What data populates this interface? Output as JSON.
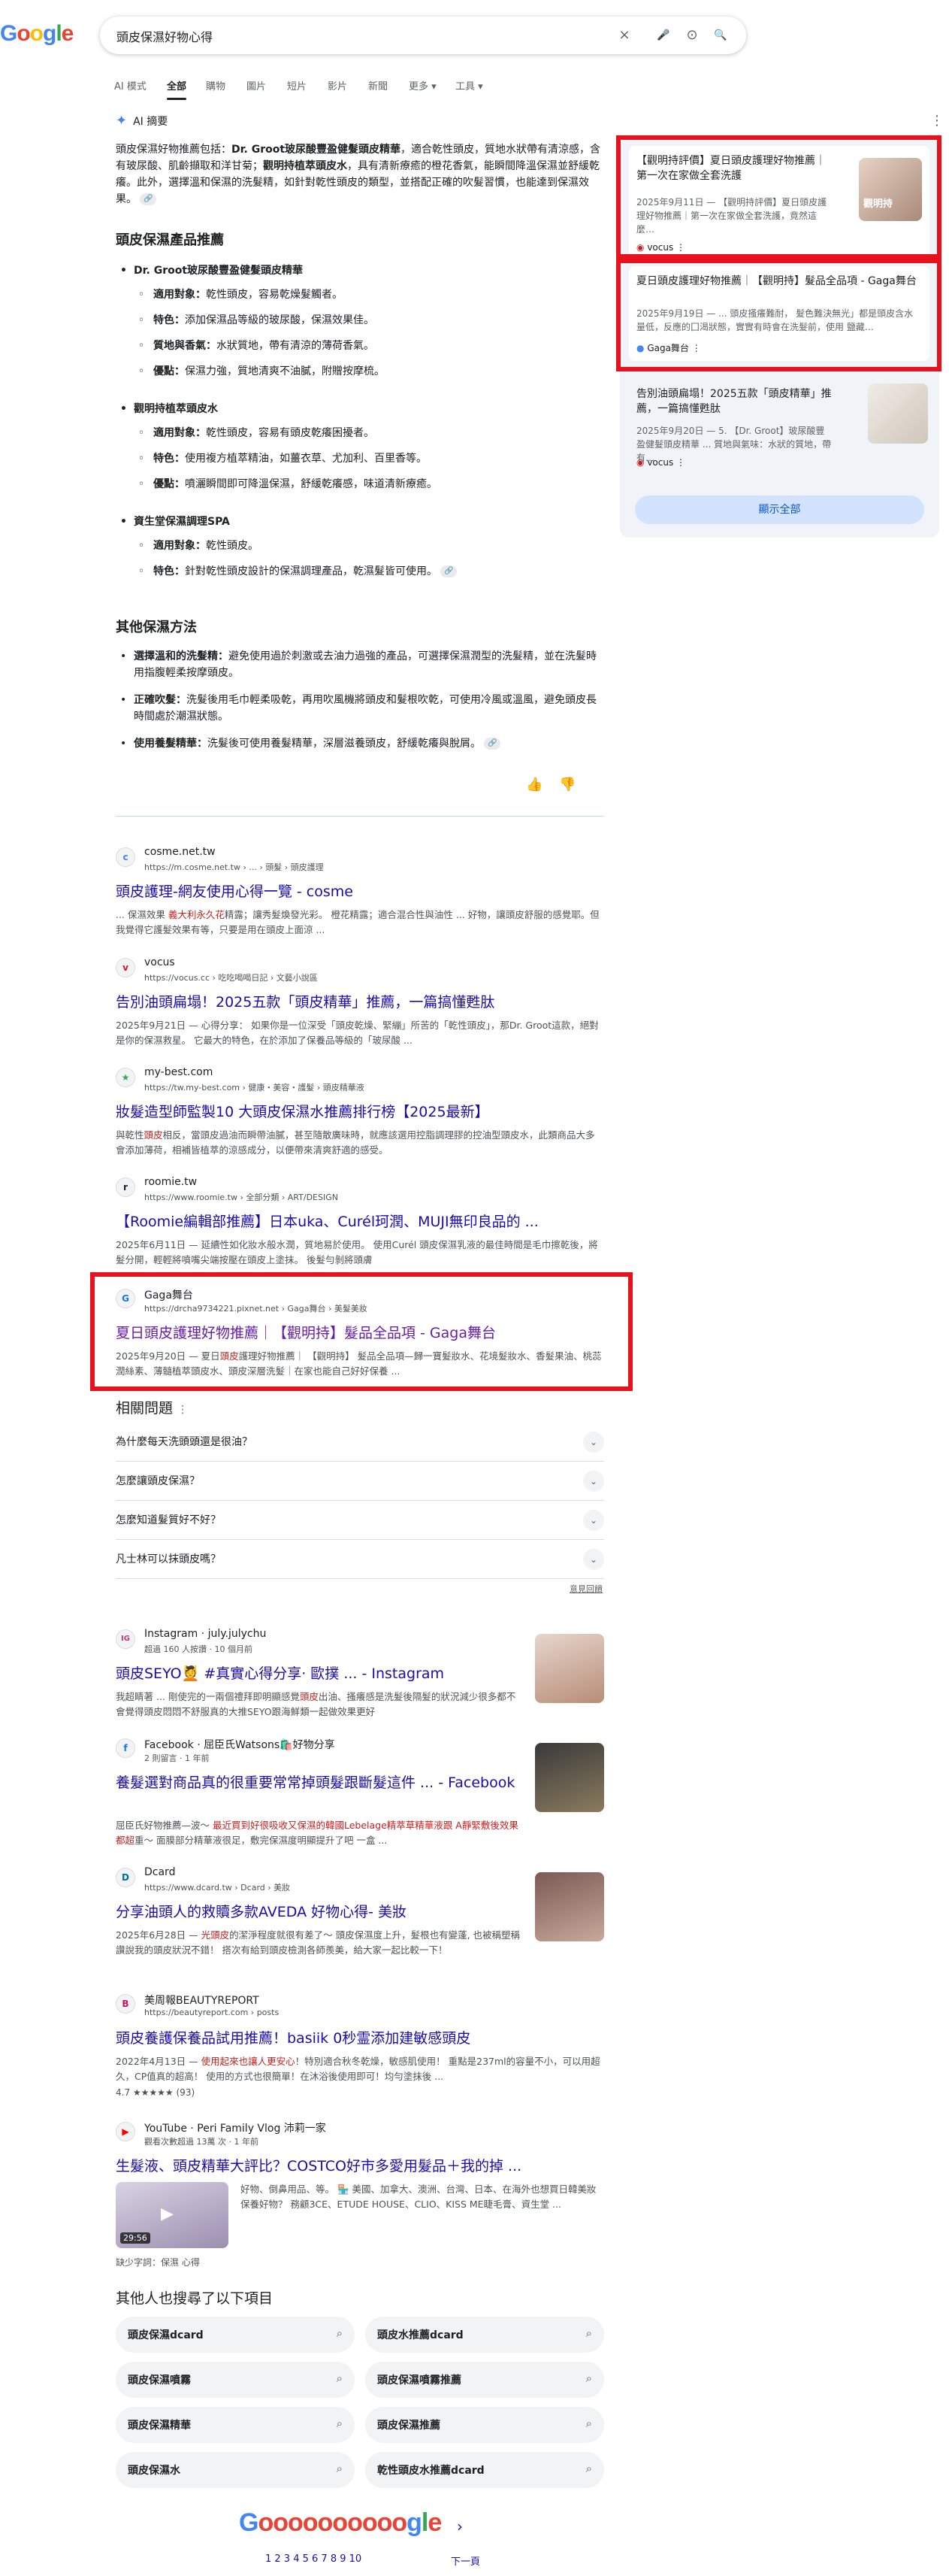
{
  "search": {
    "query": "頭皮保濕好物心得",
    "clear_label": "×",
    "voice_label": "🎤",
    "lens_label": "⊙",
    "search_label": "🔍"
  },
  "tabs": [
    {
      "label": "AI 模式"
    },
    {
      "label": "全部"
    },
    {
      "label": "購物"
    },
    {
      "label": "圖片"
    },
    {
      "label": "短片"
    },
    {
      "label": "影片"
    },
    {
      "label": "新聞"
    },
    {
      "label": "更多 ▾"
    },
    {
      "label": "工具 ▾"
    }
  ],
  "ai": {
    "title": "AI 摘要",
    "intro_1": "頭皮保濕好物推薦包括：",
    "intro_b1": "Dr. Groot玻尿酸豐盈健髮頭皮精華",
    "intro_2": "，適合乾性頭皮，質地水狀帶有清涼感，含有玻尿酸、肌齡擷取和洋甘菊；",
    "intro_b2": "觀明持植萃頭皮水",
    "intro_3": "，具有清新療癒的橙花香氣，能瞬間降溫保濕並舒緩乾癢。此外，選擇溫和保濕的洗髮精，如針對乾性頭皮的類型，並搭配正確的吹髮習慣，也能達到保濕效果。",
    "sec1": "頭皮保濕產品推薦",
    "products": [
      {
        "name": "Dr. Groot玻尿酸豐盈健髮頭皮精華",
        "points": [
          {
            "k": "適用對象：",
            "v": "乾性頭皮，容易乾燥髮觸者。"
          },
          {
            "k": "特色：",
            "v": "添加保濕品等級的玻尿酸，保濕效果佳。"
          },
          {
            "k": "質地與香氣：",
            "v": "水狀質地，帶有清涼的薄荷香氣。"
          },
          {
            "k": "優點：",
            "v": "保濕力強，質地清爽不油膩，附贈按摩梳。"
          }
        ]
      },
      {
        "name": "觀明持植萃頭皮水",
        "points": [
          {
            "k": "適用對象：",
            "v": "乾性頭皮，容易有頭皮乾癢困擾者。"
          },
          {
            "k": "特色：",
            "v": "使用複方植萃精油，如薑衣草、尤加利、百里香等。"
          },
          {
            "k": "優點：",
            "v": "噴灑瞬間即可降溫保濕，舒緩乾癢感，味道清新療癒。"
          }
        ]
      },
      {
        "name": "資生堂保濕調理SPA",
        "points": [
          {
            "k": "適用對象：",
            "v": "乾性頭皮。"
          },
          {
            "k": "特色：",
            "v": "針對乾性頭皮設計的保濕調理產品，乾濕髮皆可使用。"
          }
        ]
      }
    ],
    "sec2": "其他保濕方法",
    "methods": [
      {
        "k": "選擇溫和的洗髮精：",
        "v": "避免使用過於刺激或去油力過強的產品，可選擇保濕潤型的洗髮精，並在洗髮時用指腹輕柔按摩頭皮。"
      },
      {
        "k": "正確吹髮：",
        "v": "洗髮後用毛巾輕柔吸乾，再用吹風機將頭皮和髮根吹乾，可使用冷風或溫風，避免頭皮長時間處於潮濕狀態。"
      },
      {
        "k": "使用養髮精華：",
        "v": "洗髮後可使用養髮精華，深層滋養頭皮，舒緩乾癢與脫屑。"
      }
    ],
    "thumb_up": "👍",
    "thumb_down": "👎",
    "more_dots": "⋮",
    "chip": "🔗"
  },
  "sources": {
    "cards": [
      {
        "title": "【觀明持評價】夏日頭皮護理好物推薦｜第一次在家做全套洗護",
        "date_desc": "2025年9月11日 — 【觀明持評價】夏日頭皮護理好物推薦｜第一次在家做全套洗護，竟然這麼…",
        "source": "vocus",
        "thumb": "觀明持"
      },
      {
        "title": "夏日頭皮護理好物推薦｜【觀明持】髮品全品項 - Gaga舞台",
        "date_desc": "2025年9月19日 — ... 頭皮搔癢難耐， 髮色難決無光」都是頭皮含水量低，反應的囗渴狀態，實實有時會在洗髮前，使用 鹽藏…",
        "source": "Gaga舞台"
      },
      {
        "title": "告別油頭扁塌！2025五款「頭皮精華」推薦，一篇搞懂甦肽",
        "date_desc": "2025年9月20日 — 5. 【Dr. Groot】玻尿酸豐盈健髮頭皮精華 ... 質地與氣味：水狀的質地，帶有…",
        "source": "vocus"
      }
    ],
    "show_all": "顯示全部"
  },
  "results": [
    {
      "site": "cosme.net.tw",
      "url": "https://m.cosme.net.tw › ... › 頭髮 › 頭皮護理",
      "title": "頭皮護理-網友使用心得一覽 - cosme",
      "snippet_a": "... 保濕效果 ",
      "em": "義大利永久花",
      "snippet_b": "精露；讓秀髮煥發光彩。 橙花精露；適合混合性與油性 ... 好物，讓頭皮舒服的感覺耶。但我覺得它護髮效果有等，只要是用在頭皮上面涼 ...",
      "fav": "c"
    },
    {
      "site": "vocus",
      "url": "https://vocus.cc › 吃吃喝喝日記 › 文藝小說區",
      "title": "告別油頭扁塌！2025五款「頭皮精華」推薦，一篇搞懂甦肽",
      "snippet_a": "2025年9月21日 — 心得分享： 如果你是一位深受「頭皮乾燥、緊繃」所苦的「乾性頭皮」，那Dr. Groot這款，絕對是你的保濕救星。 它最大的特色，在於添加了保養品等級的「玻尿酸 ...",
      "em": "",
      "snippet_b": "",
      "fav": "v"
    },
    {
      "site": "my-best.com",
      "url": "https://tw.my-best.com › 健康・美容・護髮 › 頭皮精華液",
      "title": "妝髮造型師監製10 大頭皮保濕水推薦排行榜【2025最新】",
      "snippet_a": "與乾性",
      "em": "頭皮",
      "snippet_b": "相反，當頭皮過油而瞬帶油膩，甚至隨散廣味時，就應該選用控脂調理膠的控油型頭皮水，此類商品大多會添加薄荷，相補皆植萃的涼感成分，以便帶來清爽舒適的感受。",
      "fav": "★"
    },
    {
      "site": "roomie.tw",
      "url": "https://www.roomie.tw › 全部分類 › ART/DESIGN",
      "title": "【Roomie編輯部推薦】日本uka、Curél珂潤、MUJI無印良品的 ...",
      "snippet_a": "2025年6月11日 — 延續性如化妝水般水潤，質地易於使用。 使用Curél 頭皮保濕乳液的最佳時間是毛巾擦乾後，將髮分開，輕輕將噴嘴尖端按壓在頭皮上塗抹。 後髮勻剝將頭膚",
      "em": "",
      "snippet_b": "",
      "fav": "r"
    },
    {
      "site": "Gaga舞台",
      "url": "https://drcha9734221.pixnet.net › Gaga舞台 › 美髮美妝",
      "title": "夏日頭皮護理好物推薦｜【觀明持】髮品全品項 - Gaga舞台",
      "snippet_a": "2025年9月20日 — 夏日",
      "em": "頭皮",
      "snippet_b": "護理好物推薦｜ 【觀明持】 髮品全品項—歸一寶髮妝水、花境髮妝水、香髮果油、桃蕊潤絲素、薄髓植萃頭皮水、頭皮深層洗髮｜在家也能自己好好保養 ...",
      "fav": "G"
    }
  ],
  "paa": {
    "title": "相關問題",
    "questions": [
      "為什麼每天洗頭頭還是很油？",
      "怎麼讓頭皮保濕？",
      "怎麼知道髮質好不好？",
      "凡士林可以抹頭皮嗎？"
    ],
    "feedback": "意見回饋"
  },
  "results2": [
    {
      "site": "Instagram · july.julychu",
      "meta": "超過 160 人按讚 · 10 個月前",
      "title": "頭皮SEYO💆 #真實心得分享· 歐撲 ... - Instagram",
      "snippet_a": "我超睛著 ... 剛使完的一兩個禮拜即明顯感覺",
      "em": "頭皮",
      "snippet_b": "出油、搔癢感是洗髮後隔髮的狀況減少很多都不會覺得頭皮悶悶不舒服真的大推SEYO跟海鮮類一起做效果更好",
      "fav": "IG"
    },
    {
      "site": "Facebook · 屈臣氏Watsons🛍️好物分享",
      "meta": "2 則留言 · 1 年前",
      "title": "養髮選對商品真的很重要常常掉頭髮跟斷髮這件 ... - Facebook",
      "snippet_a": "屈臣氏好物推薦—波～ ",
      "em": "最近買到好很吸收又保濕的韓國Lebelage精萃草精華液跟 A靜緊敷後效果都超",
      "snippet_b": "重～ 面膜部分精華液很足，敷完保濕度明顯提升了吧 一盒 ...",
      "fav": "f"
    },
    {
      "site": "Dcard",
      "meta": "https://www.dcard.tw › Dcard › 美妝",
      "title": "分享油頭人的救贖多款AVEDA 好物心得- 美妝",
      "snippet_a": "2025年6月28日 — ",
      "em": "光頭皮",
      "snippet_b": "的潔淨程度就很有差了～ 頭皮保濕度上升，髮根也有變蓬, 也被稱塑稱讚說我的頭皮狀況不錯！ 搭次有給到頭皮檢測各師羨美，給大家一起比較一下！",
      "fav": "D"
    },
    {
      "site": "美周報BEAUTYREPORT",
      "meta": "https://beautyreport.com › posts",
      "title": "頭皮養護保養品試用推薦！basiik 0秒霊添加建敏感頭皮",
      "snippet_a": "2022年4月13日 — ",
      "em": "使用起來也讓人更安心",
      "snippet_b": "！特別適合秋冬乾燥，敏感肌使用！ 重點是237ml的容量不小，可以用超久，CP值真的超高！ 使用的方式也很簡單！在沐浴後使用即可！均勻塗抹後 ...",
      "fav": "B",
      "rating": "4.7 ★★★★★ (93)"
    },
    {
      "site": "YouTube · Peri Family Vlog 沛莉一家",
      "meta": "觀看次數超過 13萬 次 · 1 年前",
      "title": "生髮液、頭皮精華大評比？COSTCO好市多愛用髮品＋我的掉 ...",
      "snippet_a": "好物、倒鼻用品、等。 🏪 美國、加拿大、澳洲、台灣、日本、在海外也想買日韓美妝保養好物？ 務顧3CE、ETUDE HOUSE、CLIO、KISS ME睫毛膏、資生堂 ...",
      "em": "",
      "snippet_b": "",
      "fav": "▶",
      "duration": "29:56",
      "missing": "缺少字詞：保濕 心得"
    }
  ],
  "others": {
    "title": "其他人也搜尋了以下項目",
    "items": [
      "頭皮保濕dcard",
      "頭皮水推薦dcard",
      "頭皮保濕噴霧",
      "頭皮保濕噴霧推薦",
      "頭皮保濕精華",
      "頭皮保濕推薦",
      "頭皮保濕水",
      "乾性頭皮水推薦dcard"
    ]
  },
  "pager": {
    "pages": "1  2  3  4  5  6  7  8  9  10",
    "next": "下一頁"
  }
}
